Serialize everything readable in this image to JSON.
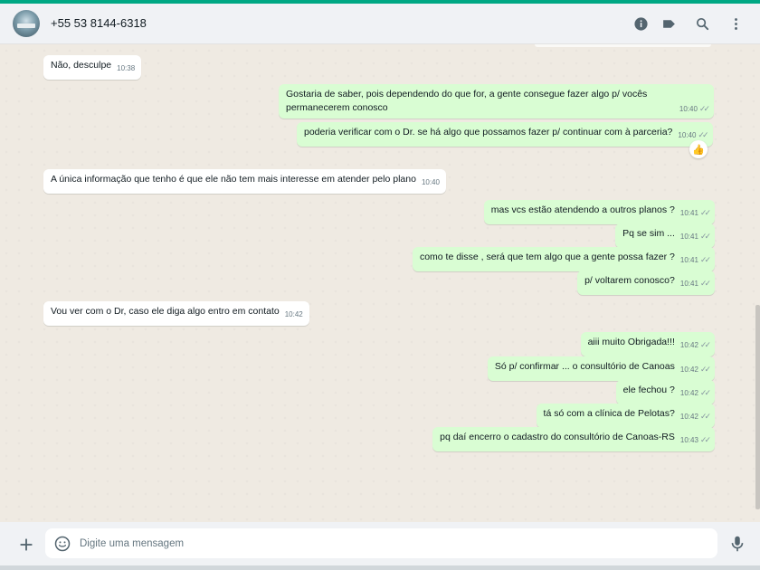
{
  "header": {
    "contact_name": "+55 53 8144-6318",
    "icons": [
      "info-icon",
      "label-icon",
      "search-icon",
      "menu-icon"
    ]
  },
  "messages": [
    {
      "dir": "in",
      "text": "Não, desculpe",
      "time": "10:38"
    },
    {
      "dir": "out",
      "text": "Gostaria de saber, pois dependendo do que for, a gente consegue fazer algo p/ vocês permanecerem conosco",
      "time": "10:40"
    },
    {
      "dir": "out",
      "text": "poderia verificar com o Dr. se há algo que possamos fazer p/ continuar com à parceria?",
      "time": "10:40",
      "reaction": "👍"
    },
    {
      "dir": "in",
      "text": "A única informação que tenho é que ele não tem mais interesse em atender pelo plano",
      "time": "10:40"
    },
    {
      "dir": "out",
      "text": "mas vcs estão atendendo a outros planos ?",
      "time": "10:41"
    },
    {
      "dir": "out",
      "text": "Pq se sim ...",
      "time": "10:41"
    },
    {
      "dir": "out",
      "text": "como te disse , será que tem algo que a gente possa fazer ?",
      "time": "10:41"
    },
    {
      "dir": "out",
      "text": "p/ voltarem conosco?",
      "time": "10:41"
    },
    {
      "dir": "in",
      "text": "Vou ver com o Dr, caso ele diga algo entro em contato",
      "time": "10:42"
    },
    {
      "dir": "out",
      "text": "aiii muito Obrigada!!!",
      "time": "10:42"
    },
    {
      "dir": "out",
      "text": "Só p/ confirmar ... o consultório de Canoas",
      "time": "10:42"
    },
    {
      "dir": "out",
      "text": "ele fechou ?",
      "time": "10:42"
    },
    {
      "dir": "out",
      "text": "tá só com a clínica de Pelotas?",
      "time": "10:42"
    },
    {
      "dir": "out",
      "text": "pq daí encerro o cadastro do consultório de Canoas-RS",
      "time": "10:43"
    }
  ],
  "composer": {
    "placeholder": "Digite uma mensagem"
  },
  "colors": {
    "accent": "#00a884",
    "incoming_bubble": "#ffffff",
    "outgoing_bubble": "#d9fdd3",
    "chat_background": "#efeae2"
  }
}
